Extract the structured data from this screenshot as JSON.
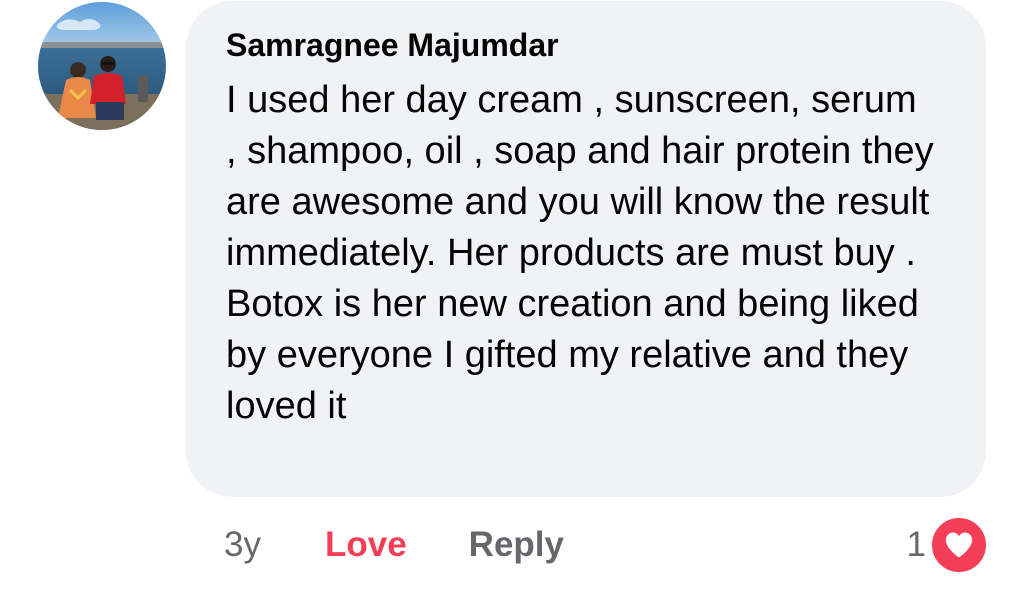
{
  "comment": {
    "author": "Samragnee Majumdar",
    "text": "I used her day cream , sunscreen, serum , shampoo, oil , soap and hair protein they are awesome and you will know the result immediately. Her products are must buy . Botox is her new creation and being liked by everyone I gifted my relative and they loved it",
    "timestamp": "3y",
    "actions": {
      "love": "Love",
      "reply": "Reply"
    },
    "reactions": {
      "count": "1",
      "type": "love"
    }
  },
  "icons": {
    "reaction": "heart-icon",
    "avatar": "profile-photo"
  },
  "colors": {
    "bubble_bg": "#f0f2f5",
    "love": "#f33e58",
    "muted": "#65676b",
    "text": "#050505"
  }
}
